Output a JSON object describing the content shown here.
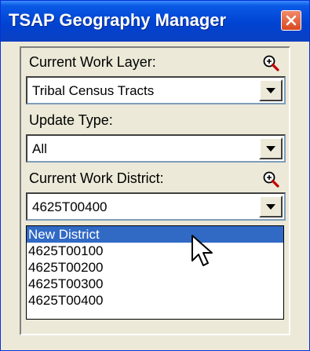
{
  "window": {
    "title": "TSAP Geography Manager"
  },
  "work_layer": {
    "label": "Current Work Layer:",
    "value": "Tribal Census Tracts"
  },
  "update_type": {
    "label": "Update Type:",
    "value": "All"
  },
  "work_district": {
    "label": "Current Work District:",
    "value": "4625T00400",
    "options": [
      "New District",
      "4625T00100",
      "4625T00200",
      "4625T00300",
      "4625T00400"
    ],
    "highlighted": "New District"
  },
  "colors": {
    "title_bar": "#0043d1",
    "selection": "#316ac5",
    "close_button": "#d9481f"
  },
  "icons": {
    "zoom": "zoom-in-icon",
    "close": "close-icon",
    "arrow": "chevron-down-icon",
    "cursor": "mouse-cursor-icon"
  }
}
